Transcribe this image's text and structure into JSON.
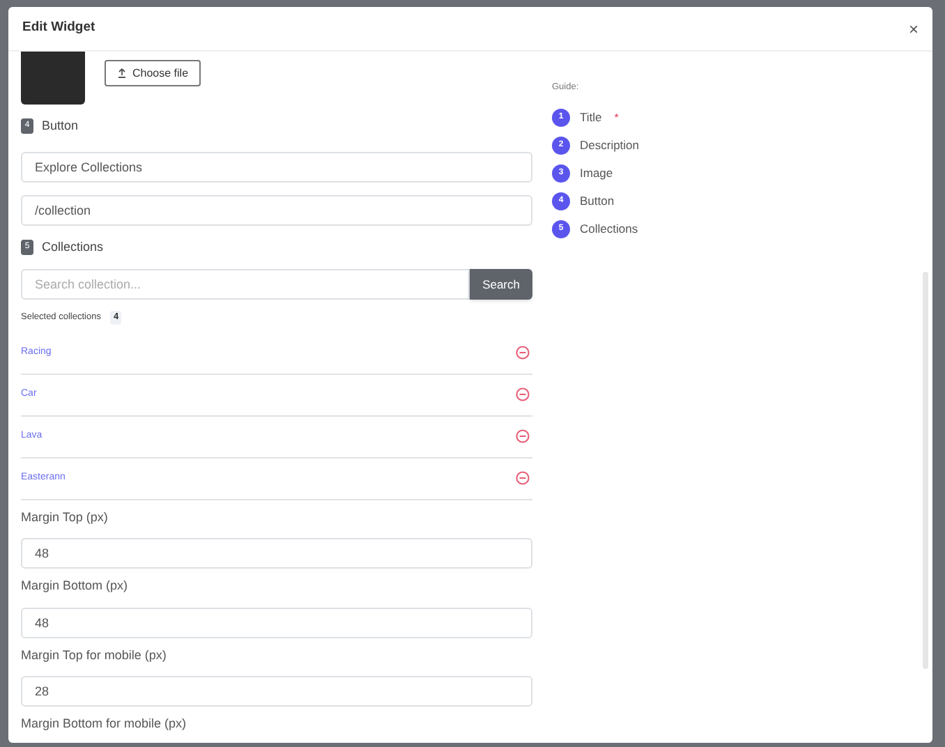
{
  "modal": {
    "title": "Edit Widget",
    "close": "×"
  },
  "image_section": {
    "choose_file": "Choose file"
  },
  "button_section": {
    "number": "4",
    "label": "Button",
    "text_value": "Explore Collections",
    "link_value": "/collection"
  },
  "collections_section": {
    "number": "5",
    "label": "Collections",
    "search_placeholder": "Search collection...",
    "search_button": "Search",
    "selected_label": "Selected collections",
    "selected_count": "4",
    "items": [
      {
        "name": "Racing"
      },
      {
        "name": "Car"
      },
      {
        "name": "Lava"
      },
      {
        "name": "Easterann"
      }
    ]
  },
  "margins": [
    {
      "label": "Margin Top (px)",
      "value": "48"
    },
    {
      "label": "Margin Bottom (px)",
      "value": "48"
    },
    {
      "label": "Margin Top for mobile (px)",
      "value": "28"
    },
    {
      "label": "Margin Bottom for mobile (px)"
    }
  ],
  "guide": {
    "title": "Guide:",
    "required_mark": "*",
    "items": [
      {
        "number": "1",
        "label": "Title",
        "required": true
      },
      {
        "number": "2",
        "label": "Description",
        "required": false
      },
      {
        "number": "3",
        "label": "Image",
        "required": false
      },
      {
        "number": "4",
        "label": "Button",
        "required": false
      },
      {
        "number": "5",
        "label": "Collections",
        "required": false
      }
    ]
  }
}
